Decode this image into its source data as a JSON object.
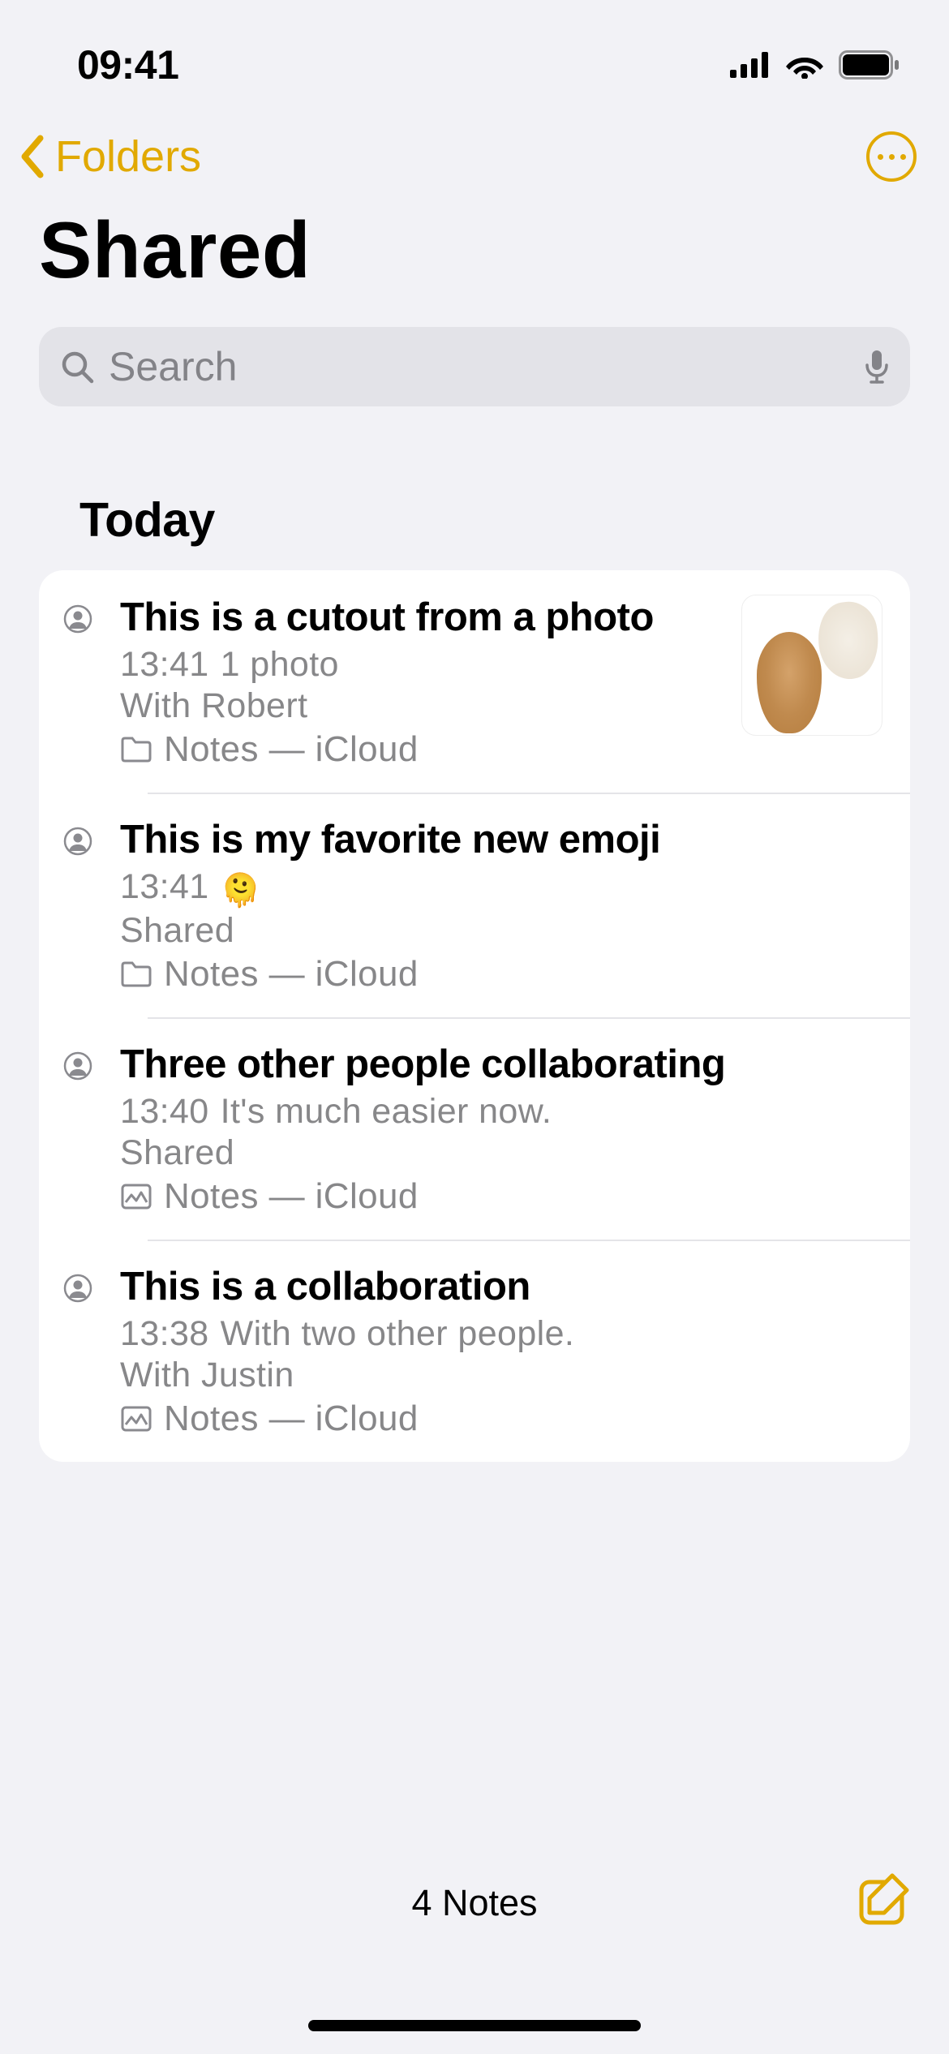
{
  "status": {
    "time": "09:41"
  },
  "nav": {
    "back_label": "Folders"
  },
  "page": {
    "title": "Shared"
  },
  "search": {
    "placeholder": "Search"
  },
  "section": {
    "header": "Today"
  },
  "notes": [
    {
      "title": "This is a cutout from a photo",
      "time": "13:41",
      "preview": "1 photo",
      "shared_with": "With Robert",
      "location": "Notes — iCloud",
      "loc_icon": "folder",
      "has_thumbnail": true
    },
    {
      "title": "This is my favorite new emoji",
      "time": "13:41",
      "preview_emoji": "🫠",
      "shared_with": "Shared",
      "location": "Notes — iCloud",
      "loc_icon": "folder"
    },
    {
      "title": "Three other people collaborating",
      "time": "13:40",
      "preview": "It's much easier now.",
      "shared_with": "Shared",
      "location": "Notes — iCloud",
      "loc_icon": "gallery"
    },
    {
      "title": "This is a collaboration",
      "time": "13:38",
      "preview": "With two other people.",
      "shared_with": "With Justin",
      "location": "Notes — iCloud",
      "loc_icon": "gallery"
    }
  ],
  "toolbar": {
    "count_label": "4 Notes"
  }
}
